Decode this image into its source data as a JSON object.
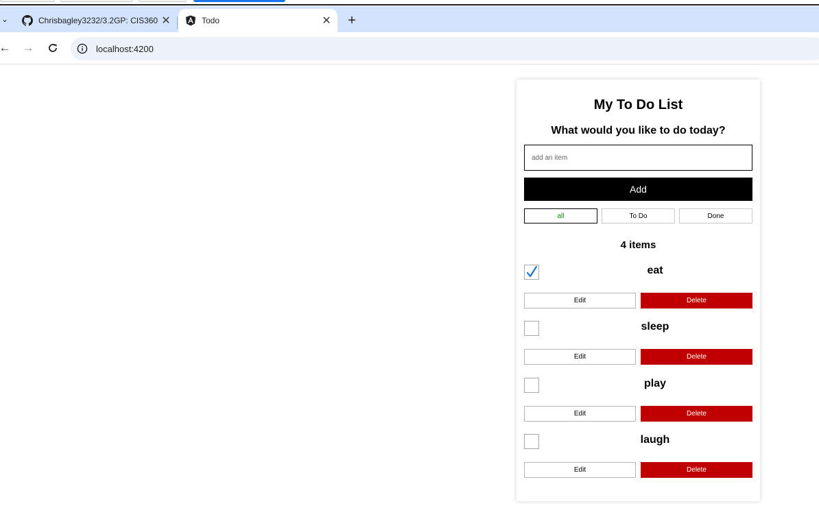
{
  "browser": {
    "tabs": [
      {
        "title": "Chrisbagley3232/3.2GP: CIS360",
        "icon": "github-icon",
        "active": false
      },
      {
        "title": "Todo",
        "icon": "angular-icon",
        "active": true
      }
    ],
    "address": "localhost:4200"
  },
  "app": {
    "title": "My To Do List",
    "subtitle": "What would you like to do today?",
    "input_placeholder": "add an item",
    "input_value": "",
    "add_label": "Add",
    "filters": {
      "all": "all",
      "todo": "To Do",
      "done": "Done",
      "selected": "all"
    },
    "count_text": "4 items",
    "items": [
      {
        "label": "eat",
        "done": true,
        "edit_label": "Edit",
        "delete_label": "Delete"
      },
      {
        "label": "sleep",
        "done": false,
        "edit_label": "Edit",
        "delete_label": "Delete"
      },
      {
        "label": "play",
        "done": false,
        "edit_label": "Edit",
        "delete_label": "Delete"
      },
      {
        "label": "laugh",
        "done": false,
        "edit_label": "Edit",
        "delete_label": "Delete"
      }
    ]
  },
  "colors": {
    "tabbar": "#d3e3fd",
    "omnibox": "#edf2fa",
    "add_button": "#000000",
    "delete_button": "#c00000",
    "selected_filter_text": "#1a7f1a",
    "checkmark": "#1a73c8"
  }
}
